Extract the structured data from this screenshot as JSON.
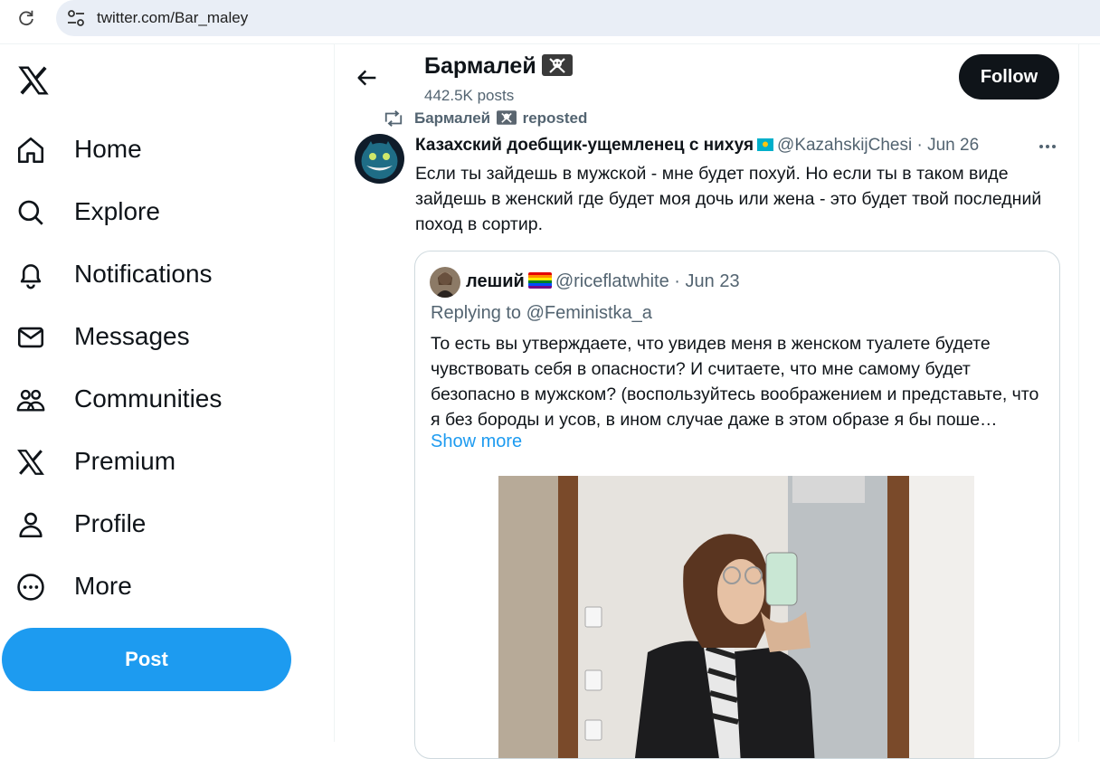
{
  "browser": {
    "url": "twitter.com/Bar_maley"
  },
  "nav": {
    "items": [
      {
        "label": "Home",
        "icon": "home-icon"
      },
      {
        "label": "Explore",
        "icon": "search-icon"
      },
      {
        "label": "Notifications",
        "icon": "bell-icon"
      },
      {
        "label": "Messages",
        "icon": "envelope-icon"
      },
      {
        "label": "Communities",
        "icon": "people-icon"
      },
      {
        "label": "Premium",
        "icon": "x-logo-icon"
      },
      {
        "label": "Profile",
        "icon": "person-icon"
      },
      {
        "label": "More",
        "icon": "more-circle-icon"
      }
    ],
    "post_label": "Post"
  },
  "profile": {
    "name": "Бармалей",
    "posts": "442.5K posts",
    "follow_label": "Follow"
  },
  "repost": {
    "name": "Бармалей",
    "suffix": "reposted"
  },
  "tweet": {
    "author": "Казахский доебщик-ущемленец с нихуя",
    "handle": "@KazahskijChesi",
    "date": "· Jun 26",
    "text": "Если ты зайдешь в мужской - мне будет похуй. Но если ты в таком виде зайдешь в женский где будет моя дочь или жена - это будет твой последний поход в сортир."
  },
  "quote": {
    "author": "леший",
    "handle": "@riceflatwhite",
    "date": "· Jun 23",
    "replying_prefix": "Replying to",
    "replying_to": "@Feministka_a",
    "text": "То есть вы утверждаете, что увидев меня в женском туалете будете чувствовать себя в опасности? И считаете, что мне самому будет безопасно в мужском? (воспользуйтесь воображением и представьте, что я без бороды и усов, в ином случае даже в этом образе я бы поше…",
    "show_more": "Show more"
  },
  "colors": {
    "accent": "#1d9bf0",
    "text": "#0f1419",
    "secondary": "#536471",
    "border": "#cfd9de"
  }
}
